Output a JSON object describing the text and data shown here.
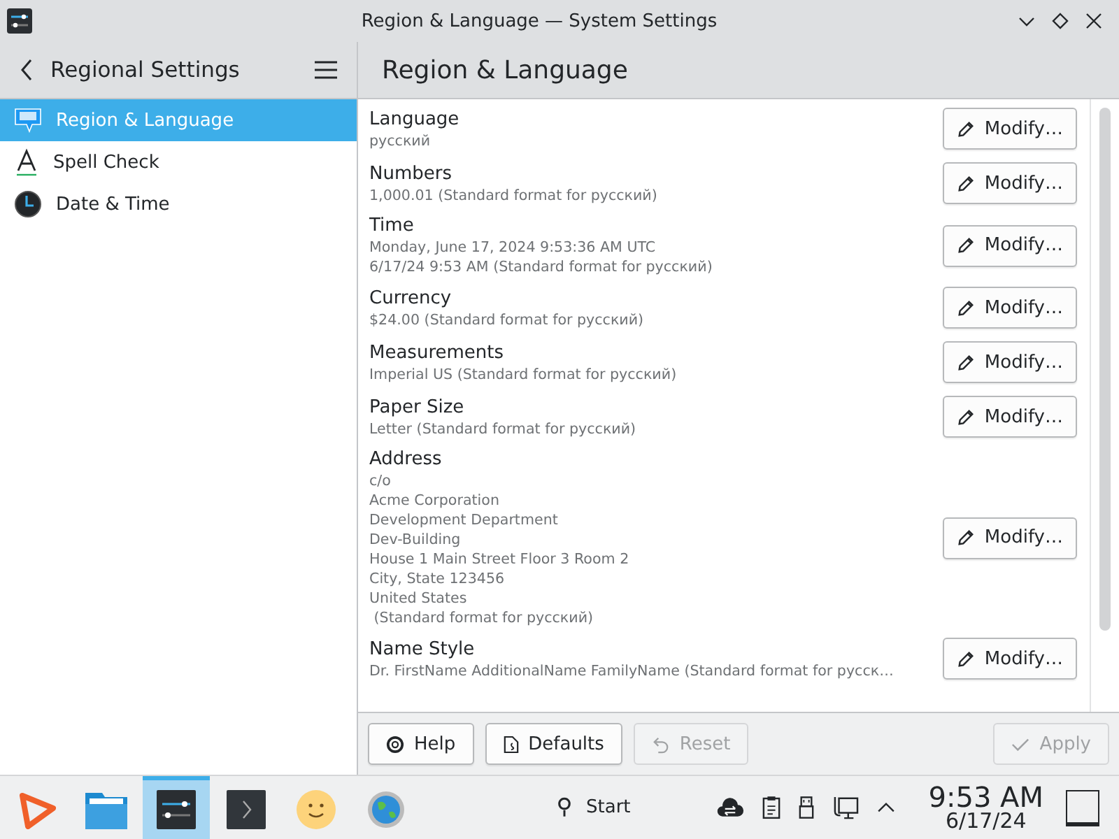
{
  "window": {
    "title": "Region & Language — System Settings"
  },
  "sidebar": {
    "title": "Regional Settings",
    "items": [
      {
        "label": "Region & Language",
        "selected": true
      },
      {
        "label": "Spell Check",
        "selected": false
      },
      {
        "label": "Date & Time",
        "selected": false
      }
    ]
  },
  "page": {
    "title": "Region & Language",
    "settings": [
      {
        "label": "Language",
        "lines": [
          "русский"
        ],
        "button": "Modify…"
      },
      {
        "label": "Numbers",
        "lines": [
          "1,000.01 (Standard format for русский)"
        ],
        "button": "Modify…"
      },
      {
        "label": "Time",
        "lines": [
          "Monday, June 17, 2024 9:53:36 AM UTC",
          "6/17/24 9:53 AM (Standard format for русский)"
        ],
        "button": "Modify…"
      },
      {
        "label": "Currency",
        "lines": [
          "$24.00 (Standard format for русский)"
        ],
        "button": "Modify…"
      },
      {
        "label": "Measurements",
        "lines": [
          "Imperial US (Standard format for русский)"
        ],
        "button": "Modify…"
      },
      {
        "label": "Paper Size",
        "lines": [
          "Letter (Standard format for русский)"
        ],
        "button": "Modify…"
      },
      {
        "label": "Address",
        "lines": [
          "c/o",
          "Acme Corporation",
          "Development Department",
          "Dev-Building",
          "House 1 Main Street Floor 3 Room 2",
          "City, State 123456",
          "United States",
          " (Standard format for русский)"
        ],
        "button": "Modify…"
      },
      {
        "label": "Name Style",
        "lines": [
          "Dr. FirstName AdditionalName FamilyName (Standard format for русск…"
        ],
        "button": "Modify…"
      }
    ]
  },
  "footer": {
    "buttons": [
      {
        "label": "Help",
        "disabled": false
      },
      {
        "label": "Defaults",
        "disabled": false
      },
      {
        "label": "Reset",
        "disabled": true
      },
      {
        "label": "Apply",
        "disabled": true
      }
    ]
  },
  "taskbar": {
    "apps": [
      {
        "active": false
      },
      {
        "active": false
      },
      {
        "active": true
      },
      {
        "active": false
      },
      {
        "active": false
      },
      {
        "active": false
      }
    ],
    "activity": "Start",
    "time": "9:53 AM",
    "date": "6/17/24"
  }
}
